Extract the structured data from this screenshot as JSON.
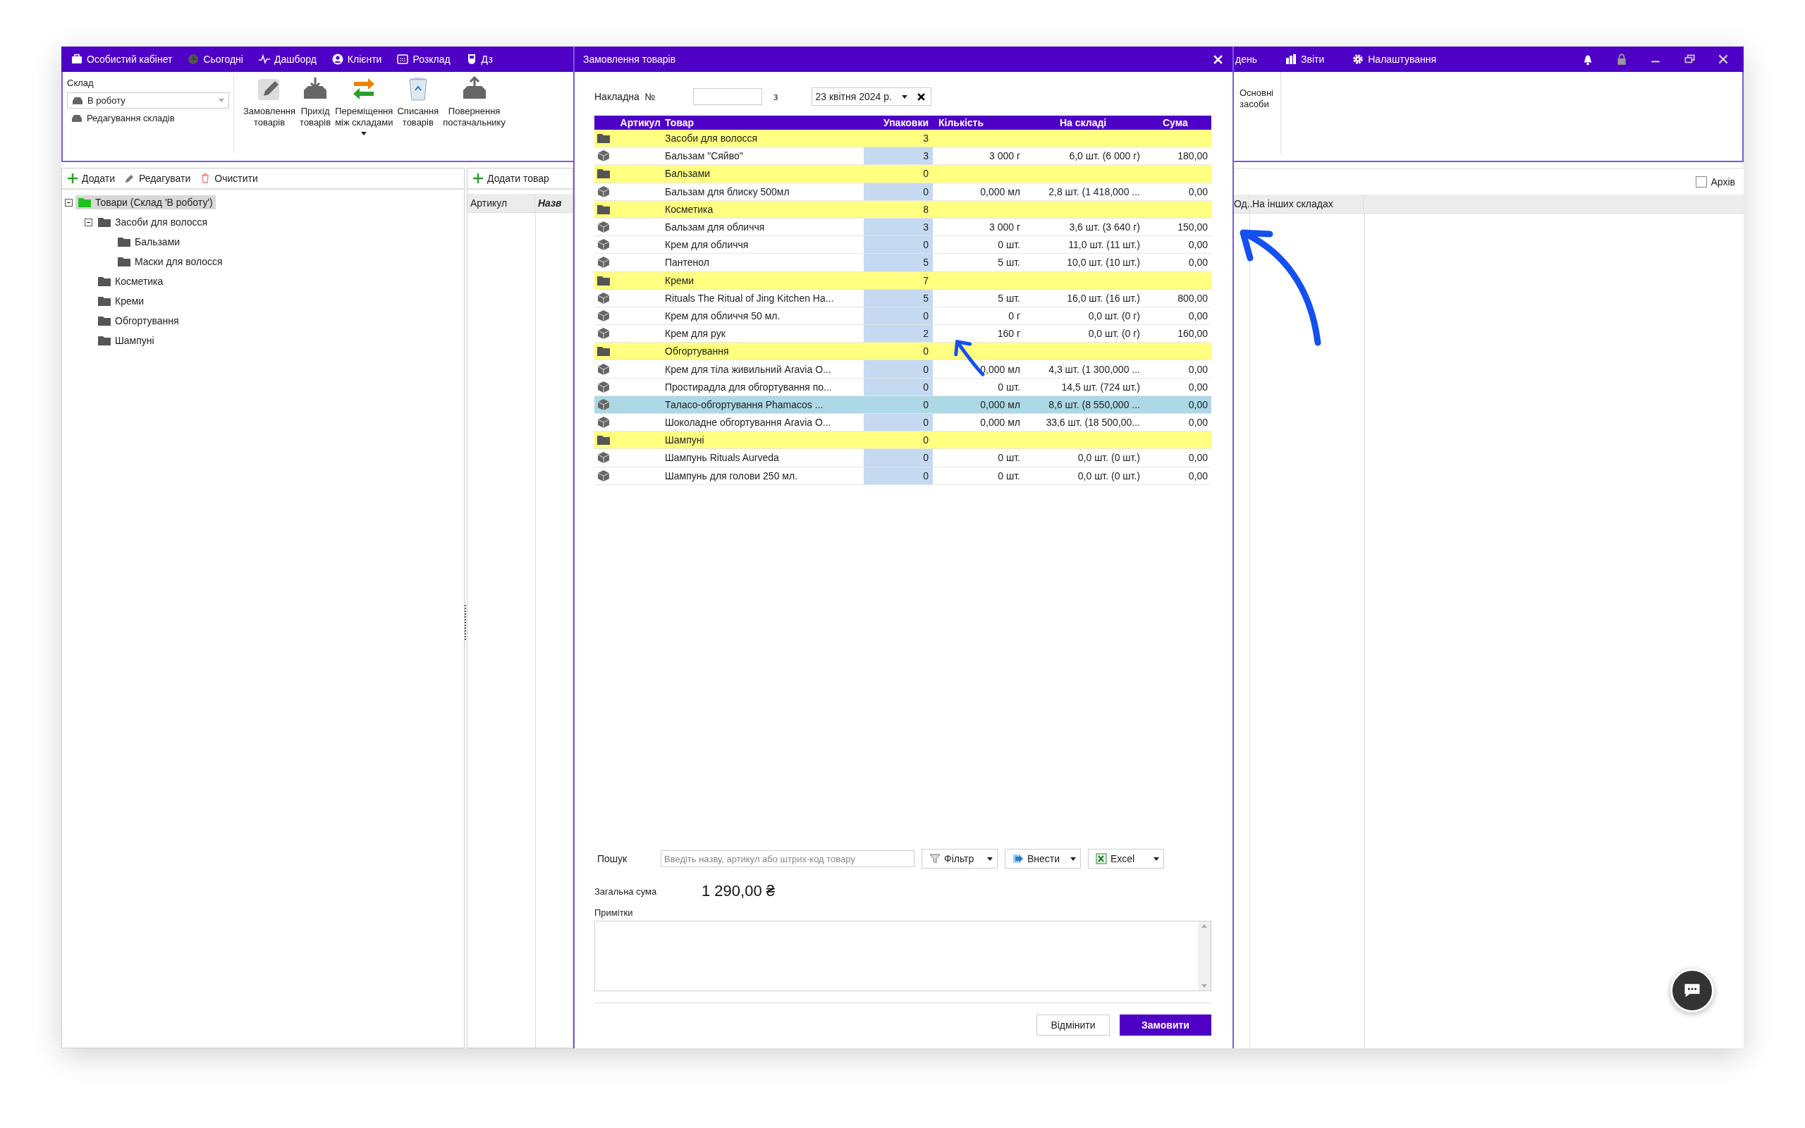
{
  "app_bar": {
    "left_items": [
      "Особистий кабінет",
      "Сьогодні",
      "Дашборд",
      "Клієнти",
      "Розклад",
      "Дз"
    ],
    "right_items": [
      "день",
      "Звіти",
      "Налаштування"
    ]
  },
  "warehouse_panel": {
    "label": "Склад",
    "select_value": "В роботу",
    "edit_link": "Редагування складів"
  },
  "toolbar": [
    {
      "label": "Замовлення\nтоварів",
      "has_menu": false
    },
    {
      "label": "Прихід\nтоварів",
      "has_menu": false
    },
    {
      "label": "Переміщення\nміж складами",
      "has_menu": true
    },
    {
      "label": "Списання\nтоварів",
      "has_menu": false
    },
    {
      "label": "Повернення\nпостачальнику",
      "has_menu": false
    }
  ],
  "toolbar_right": [
    "Основні\nзасоби"
  ],
  "tree_toolbar": [
    "Додати",
    "Редагувати",
    "Очистити"
  ],
  "tree": [
    {
      "label": "Товари (Склад 'В роботу')",
      "selected": true,
      "expanded": true,
      "children": [
        {
          "label": "Засоби для волосся",
          "selected": false,
          "expanded": true,
          "children": [
            {
              "label": "Бальзами",
              "selected": false
            },
            {
              "label": "Маски для волосся",
              "selected": false
            }
          ]
        },
        {
          "label": "Косметика",
          "selected": false
        },
        {
          "label": "Креми",
          "selected": false
        },
        {
          "label": "Обгортування",
          "selected": false
        },
        {
          "label": "Шампуні",
          "selected": false
        }
      ]
    }
  ],
  "products_panel": {
    "add_button": "Додати товар",
    "columns": [
      "Артикул",
      "Назв"
    ]
  },
  "right_panel": {
    "archive": {
      "label": "Архів",
      "checked": false
    },
    "columns": [
      "Од..",
      "На інших складах"
    ]
  },
  "dialog": {
    "title": "Замовлення товарів",
    "invoice_label": "Накладна  №",
    "date_label": "з",
    "date_value": "23 квітня 2024 р.",
    "columns": [
      "Артикул",
      "Товар",
      "Упаковки",
      "Кількість",
      "На складі",
      "Сума"
    ],
    "rows": [
      {
        "kind": "group",
        "name": "Засоби для волосся",
        "packs": "3",
        "selected": false
      },
      {
        "kind": "product",
        "name": "Бальзам \"Сяйво\"",
        "packs": "3",
        "qty": "3 000 г",
        "stock": "6,0 шт. (6 000 г)",
        "sum": "180,00",
        "selected": false
      },
      {
        "kind": "group",
        "name": "Бальзами",
        "packs": "0",
        "selected": false
      },
      {
        "kind": "product",
        "name": "Бальзам для блиску 500мл",
        "packs": "0",
        "qty": "0,000 мл",
        "stock": "2,8 шт. (1 418,000 ...",
        "sum": "0,00",
        "selected": false
      },
      {
        "kind": "group",
        "name": "Косметика",
        "packs": "8",
        "selected": false
      },
      {
        "kind": "product",
        "name": "Бальзам для обличчя",
        "packs": "3",
        "qty": "3 000 г",
        "stock": "3,6 шт. (3 640 г)",
        "sum": "150,00",
        "selected": false
      },
      {
        "kind": "product",
        "name": "Крем для обличчя",
        "packs": "0",
        "qty": "0 шт.",
        "stock": "11,0 шт. (11 шт.)",
        "sum": "0,00",
        "selected": false
      },
      {
        "kind": "product",
        "name": "Пантенол",
        "packs": "5",
        "qty": "5 шт.",
        "stock": "10,0 шт. (10 шт.)",
        "sum": "0,00",
        "selected": false
      },
      {
        "kind": "group",
        "name": "Креми",
        "packs": "7",
        "selected": false
      },
      {
        "kind": "product",
        "name": "Rituals The Ritual of Jing Kitchen Ha...",
        "packs": "5",
        "qty": "5 шт.",
        "stock": "16,0 шт. (16 шт.)",
        "sum": "800,00",
        "selected": false
      },
      {
        "kind": "product",
        "name": "Крем для обличчя 50 мл.",
        "packs": "0",
        "qty": "0 г",
        "stock": "0,0 шт. (0 г)",
        "sum": "0,00",
        "selected": false
      },
      {
        "kind": "product",
        "name": "Крем для рук",
        "packs": "2",
        "qty": "160 г",
        "stock": "0,0 шт. (0 г)",
        "sum": "160,00",
        "selected": false
      },
      {
        "kind": "group",
        "name": "Обгортування",
        "packs": "0",
        "selected": false
      },
      {
        "kind": "product",
        "name": "Крем для тіла живильний Aravia O...",
        "packs": "0",
        "qty": "0,000 мл",
        "stock": "4,3 шт. (1 300,000 ...",
        "sum": "0,00",
        "selected": false
      },
      {
        "kind": "product",
        "name": "Простирадла для обгортування по...",
        "packs": "0",
        "qty": "0 шт.",
        "stock": "14,5 шт. (724 шт.)",
        "sum": "0,00",
        "selected": false
      },
      {
        "kind": "product",
        "name": "Таласо-обгортування Phamacos ...",
        "packs": "0",
        "qty": "0,000 мл",
        "stock": "8,6 шт. (8 550,000 ...",
        "sum": "0,00",
        "selected": true
      },
      {
        "kind": "product",
        "name": "Шоколадне обгортування Aravia O...",
        "packs": "0",
        "qty": "0,000 мл",
        "stock": "33,6 шт. (18 500,00...",
        "sum": "0,00",
        "selected": false
      },
      {
        "kind": "group",
        "name": "Шампуні",
        "packs": "0",
        "selected": false
      },
      {
        "kind": "product",
        "name": "Шампунь Rituals Aurveda",
        "packs": "0",
        "qty": "0 шт.",
        "stock": "0,0 шт. (0 шт.)",
        "sum": "0,00",
        "selected": false
      },
      {
        "kind": "product",
        "name": "Шампунь для голови 250 мл.",
        "packs": "0",
        "qty": "0 шт.",
        "stock": "0,0 шт. (0 шт.)",
        "sum": "0,00",
        "selected": false
      }
    ],
    "search": {
      "label": "Пошук",
      "placeholder": "Введіть назву, артикул або штрих-код товару"
    },
    "tool_buttons": [
      "Фільтр",
      "Внести",
      "Excel"
    ],
    "total_label": "Загальна сума",
    "total_value": "1 290,00 ₴",
    "notes_label": "Примітки",
    "cancel_button": "Відмінити",
    "submit_button": "Замовити"
  }
}
